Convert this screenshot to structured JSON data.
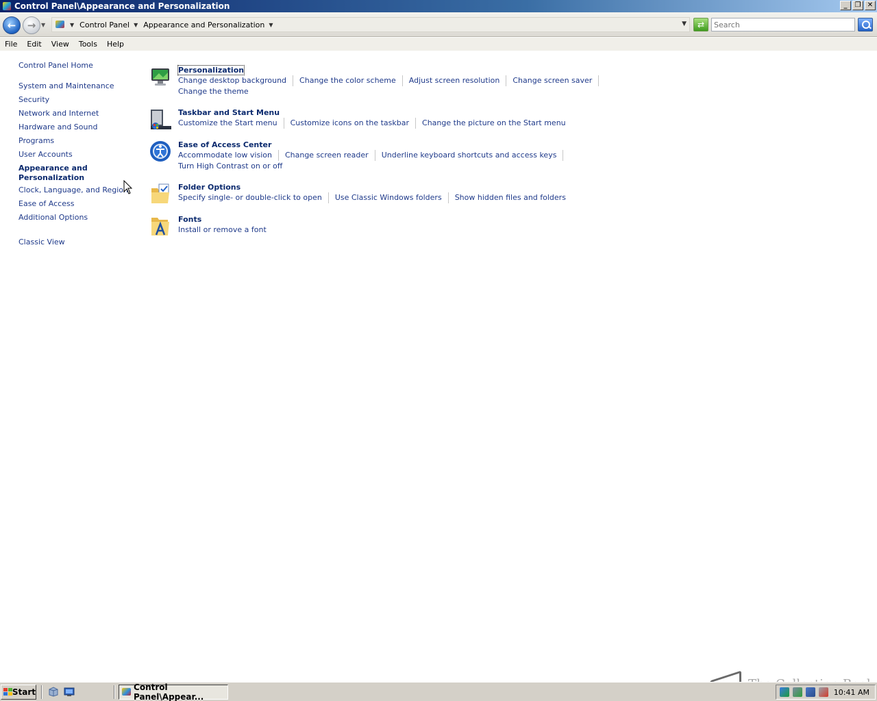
{
  "window": {
    "title": "Control Panel\\Appearance and Personalization",
    "buttons": {
      "minimize": "_",
      "restore": "❐",
      "close": "✕"
    }
  },
  "address_bar": {
    "crumbs": [
      "Control Panel",
      "Appearance and Personalization"
    ],
    "search_placeholder": "Search"
  },
  "menu": [
    "File",
    "Edit",
    "View",
    "Tools",
    "Help"
  ],
  "sidebar": {
    "home": "Control Panel Home",
    "items": [
      "System and Maintenance",
      "Security",
      "Network and Internet",
      "Hardware and Sound",
      "Programs",
      "User Accounts",
      "Appearance and Personalization",
      "Clock, Language, and Region",
      "Ease of Access",
      "Additional Options"
    ],
    "current_item": "Appearance and Personalization",
    "classic_view": "Classic View"
  },
  "categories": [
    {
      "title": "Personalization",
      "icon": "personalization-icon",
      "tasks": [
        "Change desktop background",
        "Change the color scheme",
        "Adjust screen resolution",
        "Change screen saver",
        "Change the theme"
      ]
    },
    {
      "title": "Taskbar and Start Menu",
      "icon": "taskbar-icon",
      "tasks": [
        "Customize the Start menu",
        "Customize icons on the taskbar",
        "Change the picture on the Start menu"
      ]
    },
    {
      "title": "Ease of Access Center",
      "icon": "ease-of-access-icon",
      "tasks": [
        "Accommodate low vision",
        "Change screen reader",
        "Underline keyboard shortcuts and access keys",
        "Turn High Contrast on or off"
      ]
    },
    {
      "title": "Folder Options",
      "icon": "folder-options-icon",
      "tasks": [
        "Specify single- or double-click to open",
        "Use Classic Windows folders",
        "Show hidden files and folders"
      ]
    },
    {
      "title": "Fonts",
      "icon": "fonts-icon",
      "tasks": [
        "Install or remove a font"
      ]
    }
  ],
  "taskbar": {
    "start": "Start",
    "active_task": "Control Panel\\Appear...",
    "clock": "10:41 AM"
  },
  "watermark": "The Collection Book",
  "colors": {
    "link": "#1f3a8a",
    "heading": "#0b2a6e",
    "titlebar": "#0a246a"
  }
}
